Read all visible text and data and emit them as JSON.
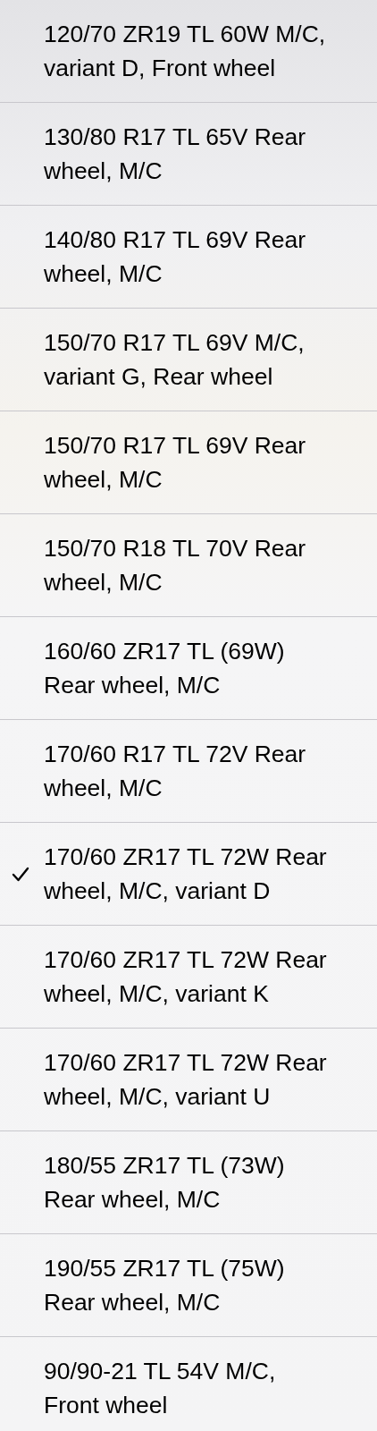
{
  "options": [
    {
      "label": "120/70 ZR19 TL 60W M/C,\nvariant D, Front wheel",
      "selected": false
    },
    {
      "label": "130/80 R17 TL 65V Rear\nwheel, M/C",
      "selected": false
    },
    {
      "label": "140/80 R17 TL 69V Rear\nwheel, M/C",
      "selected": false
    },
    {
      "label": "150/70 R17 TL 69V M/C,\nvariant G, Rear wheel",
      "selected": false
    },
    {
      "label": "150/70 R17 TL 69V Rear\nwheel, M/C",
      "selected": false
    },
    {
      "label": "150/70 R18 TL 70V Rear\nwheel, M/C",
      "selected": false
    },
    {
      "label": "160/60 ZR17 TL (69W)\nRear wheel, M/C",
      "selected": false
    },
    {
      "label": "170/60 R17 TL 72V Rear\nwheel, M/C",
      "selected": false
    },
    {
      "label": "170/60 ZR17 TL 72W Rear\nwheel, M/C, variant D",
      "selected": true
    },
    {
      "label": "170/60 ZR17 TL 72W Rear\nwheel, M/C, variant K",
      "selected": false
    },
    {
      "label": "170/60 ZR17 TL 72W Rear\nwheel, M/C, variant U",
      "selected": false
    },
    {
      "label": "180/55 ZR17 TL (73W)\nRear wheel, M/C",
      "selected": false
    },
    {
      "label": "190/55 ZR17 TL (75W)\nRear wheel, M/C",
      "selected": false
    },
    {
      "label": "90/90-21 TL 54V M/C,\nFront wheel",
      "selected": false
    }
  ]
}
